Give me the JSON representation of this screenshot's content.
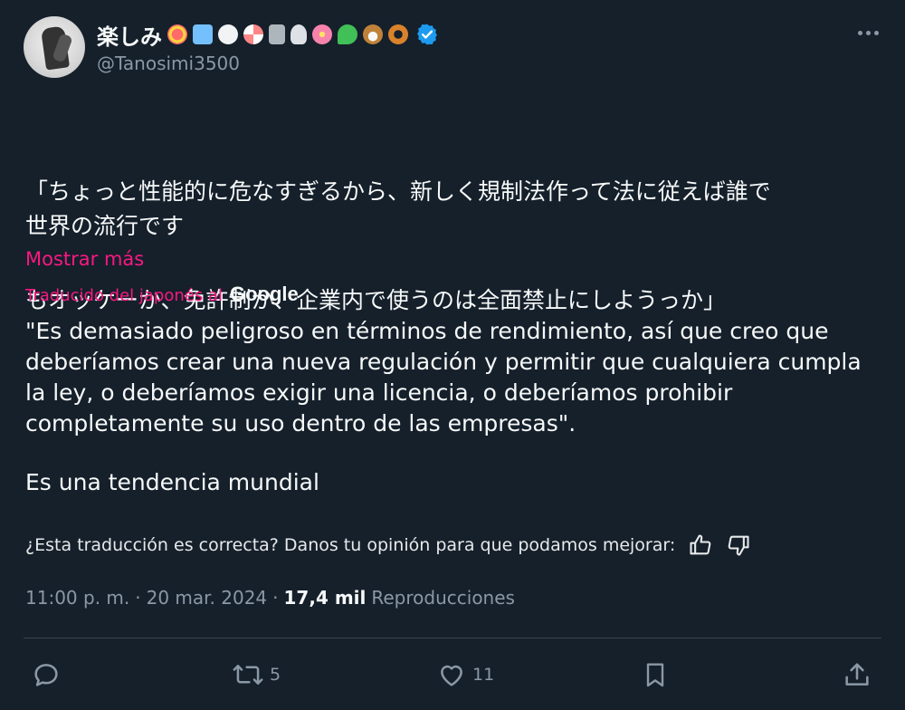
{
  "author": {
    "display_name": "楽しみ",
    "handle": "@Tanosimi3500",
    "verified": true,
    "name_emojis": [
      "lollipop-emoji",
      "roller-skate-emoji",
      "sheep-emoji",
      "candy-emoji",
      "jar-emoji",
      "ghost-emoji",
      "cherry-blossom-emoji",
      "shamrock-emoji",
      "dog-emoji",
      "pretzel-emoji"
    ]
  },
  "tweet": {
    "text_line1": "「ちょっと性能的に危なすぎるから、新しく規制法作って法に従えば誰で",
    "text_line2": "もオッケーか、免許制か、企業内で使うのは全面禁止にしようっか」",
    "text_para2": "世界の流行です",
    "show_more": "Mostrar más",
    "translated_label": "Traducido del japonés al",
    "translator": "Google",
    "translation_line1": "\"Es demasiado peligroso en términos de rendimiento, así que creo que",
    "translation_line2": "deberíamos crear una nueva regulación y permitir que cualquiera cumpla",
    "translation_line3": "la ley, o deberíamos exigir una licencia, o deberíamos prohibir",
    "translation_line4": "completamente su uso dentro de las empresas\".",
    "translation_para2": "Es una tendencia mundial",
    "feedback_prompt": "¿Esta traducción es correcta? Danos tu opinión para que podamos mejorar:"
  },
  "meta": {
    "time": "11:00 p. m.",
    "separator1": "·",
    "date": "20 mar. 2024",
    "separator2": "·",
    "views": "17,4 mil",
    "views_label": "Reproducciones"
  },
  "actions": {
    "reply_count": "",
    "retweet_count": "5",
    "like_count": "11"
  },
  "colors": {
    "background": "#15202b",
    "accent_pink": "#f91880",
    "muted": "#8b98a5",
    "verified_blue": "#1d9bf0"
  }
}
